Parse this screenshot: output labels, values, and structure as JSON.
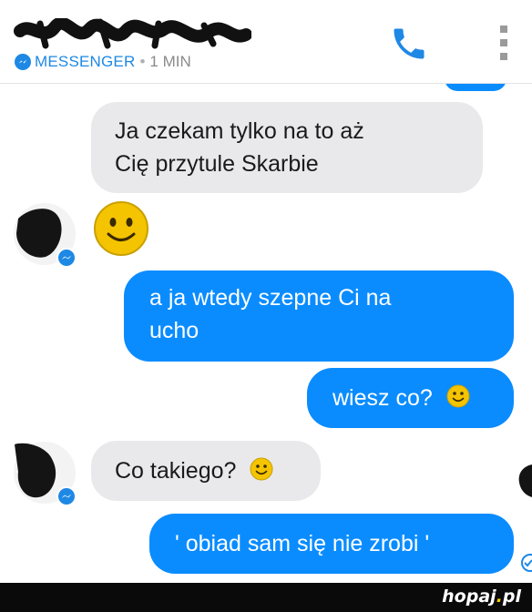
{
  "header": {
    "contact_name": "",
    "app_label": "MESSENGER",
    "separator": "•",
    "last_active": "1 MIN"
  },
  "icons": {
    "call": "phone-icon",
    "overflow": "more-vert-icon",
    "messenger_badge": "messenger-icon",
    "emoji": "smiley-icon"
  },
  "colors": {
    "accent": "#0a8cff",
    "incoming_bubble": "#e9e9ec",
    "header_accent": "#1e88e5",
    "emoji": "#f5c400"
  },
  "messages": [
    {
      "id": "m1",
      "direction": "in",
      "lines": [
        "Ja czekam tylko na to aż",
        "Cię przytule Skarbie"
      ]
    },
    {
      "id": "m2",
      "direction": "in",
      "kind": "emoji"
    },
    {
      "id": "m3",
      "direction": "out",
      "lines": [
        "a ja wtedy szepne Ci na",
        "ucho"
      ]
    },
    {
      "id": "m4",
      "direction": "out",
      "text": "wiesz co?",
      "emoji": true
    },
    {
      "id": "m5",
      "direction": "in",
      "text": "Co takiego?",
      "emoji": true
    },
    {
      "id": "m6",
      "direction": "out",
      "text": "' obiad sam się nie zrobi '"
    }
  ],
  "footer": {
    "brand": "hopaj",
    "brand_dot": ".",
    "brand_tld": "pl"
  }
}
